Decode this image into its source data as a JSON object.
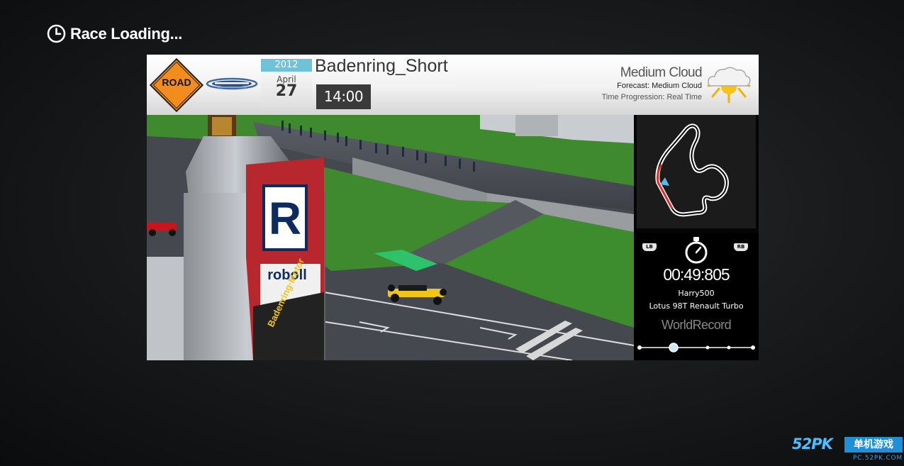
{
  "loading": {
    "title": "Race Loading..."
  },
  "header": {
    "road_label": "ROAD",
    "date": {
      "year": "2012",
      "month": "April",
      "day": "27"
    },
    "track_name": "Badenring_Short",
    "time_of_day": "14:00",
    "weather": {
      "condition": "Medium Cloud",
      "forecast": "Forecast: Medium Cloud",
      "time_progression": "Time Progression: Real Time",
      "icon": "partly-cloudy-sun-icon"
    }
  },
  "scene": {
    "billboard_brand": "roboll",
    "billboard_brand_letter": "R",
    "banner_text": "Badenring·Motor"
  },
  "record": {
    "left_button": "LB",
    "right_button": "RB",
    "lap_time": "00:49:805",
    "driver": "Harry500",
    "car": "Lotus 98T Renault Turbo",
    "record_type": "WorldRecord"
  },
  "watermark": {
    "brand": "52PK",
    "label": "单机游戏",
    "url": "PC.52PK.COM"
  },
  "colors": {
    "date_accent": "#6fc2d8",
    "road_sign": "#f28c1f",
    "grass": "#3f8a2f",
    "track_start": "#2ec26b"
  }
}
